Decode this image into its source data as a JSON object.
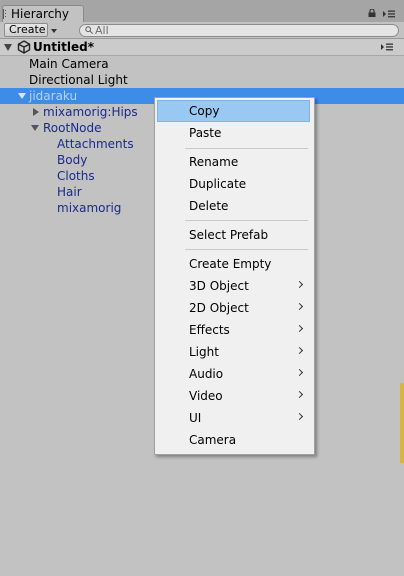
{
  "tab": {
    "label": "Hierarchy"
  },
  "toolbar": {
    "create_label": "Create",
    "search_placeholder": "All"
  },
  "scene": {
    "title": "Untitled*"
  },
  "tree": [
    {
      "label": "Main Camera"
    },
    {
      "label": "Directional Light"
    },
    {
      "label": "jidaraku",
      "selected": true
    },
    {
      "label": "mixamorig:Hips"
    },
    {
      "label": "RootNode"
    },
    {
      "label": "Attachments"
    },
    {
      "label": "Body"
    },
    {
      "label": "Cloths"
    },
    {
      "label": "Hair"
    },
    {
      "label": "mixamorig"
    }
  ],
  "context_menu": {
    "items": [
      {
        "label": "Copy",
        "highlighted": true
      },
      {
        "label": "Paste"
      },
      {
        "label": "Rename"
      },
      {
        "label": "Duplicate"
      },
      {
        "label": "Delete"
      },
      {
        "label": "Select Prefab"
      },
      {
        "label": "Create Empty"
      },
      {
        "label": "3D Object",
        "submenu": true
      },
      {
        "label": "2D Object",
        "submenu": true
      },
      {
        "label": "Effects",
        "submenu": true
      },
      {
        "label": "Light",
        "submenu": true
      },
      {
        "label": "Audio",
        "submenu": true
      },
      {
        "label": "Video",
        "submenu": true
      },
      {
        "label": "UI",
        "submenu": true
      },
      {
        "label": "Camera"
      }
    ]
  },
  "colors": {
    "selection": "#3d8ce8",
    "menu_highlight": "#99c8f2",
    "panel_bg": "#c2c2c2",
    "prefab_text": "#1a2a8a"
  }
}
